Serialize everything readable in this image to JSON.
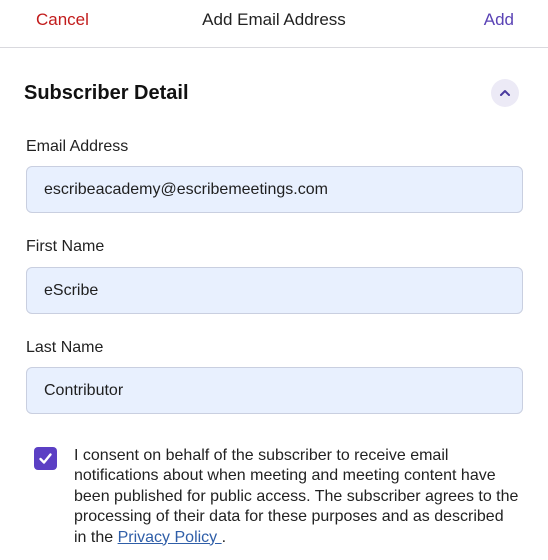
{
  "header": {
    "cancel_label": "Cancel",
    "title": "Add Email Address",
    "add_label": "Add"
  },
  "section": {
    "title": "Subscriber Detail",
    "collapse_icon": "chevron-up-icon"
  },
  "fields": {
    "email": {
      "label": "Email Address",
      "value": "escribeacademy@escribemeetings.com"
    },
    "first_name": {
      "label": "First Name",
      "value": "eScribe"
    },
    "last_name": {
      "label": "Last Name",
      "value": "Contributor"
    }
  },
  "consent": {
    "checked": true,
    "text": "I consent on behalf of the subscriber to receive email notifications about when meeting and meeting content have been published for public access. The subscriber agrees to the processing of their data for these purposes and as described in the",
    "link_label": "Privacy Policy ",
    "suffix": "."
  },
  "colors": {
    "cancel": "#c21b1b",
    "accent": "#5b3fc4",
    "link": "#2f5ea8",
    "input_bg": "#e8f0fe"
  }
}
